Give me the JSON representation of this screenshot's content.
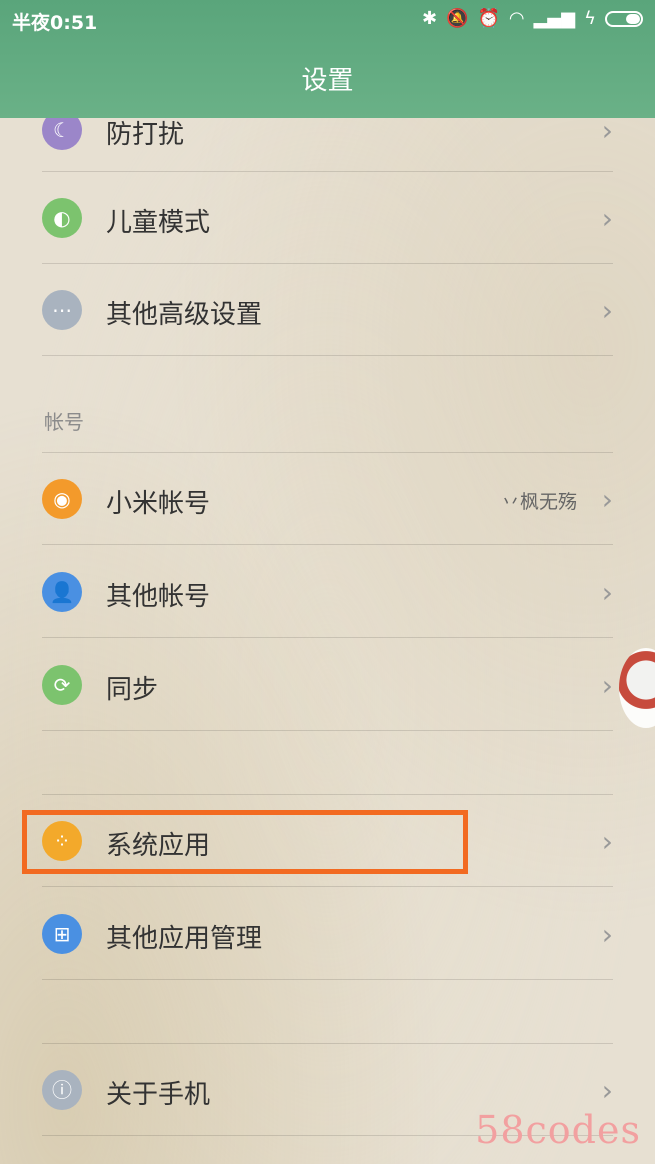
{
  "status_bar": {
    "time": "半夜0:51"
  },
  "header": {
    "title": "设置"
  },
  "items": [
    {
      "label": "防打扰",
      "icon": "moon-icon",
      "color": "#9b86c9"
    },
    {
      "label": "儿童模式",
      "icon": "child-mode-icon",
      "color": "#7cc36e"
    },
    {
      "label": "其他高级设置",
      "icon": "more-icon",
      "color": "#a9b3bf"
    }
  ],
  "account_section": {
    "title": "帐号"
  },
  "account_items": [
    {
      "label": "小米帐号",
      "value": "丷枫无殇",
      "icon": "mi-account-icon",
      "color": "#f39a2b"
    },
    {
      "label": "其他帐号",
      "icon": "user-add-icon",
      "color": "#4a90e2"
    },
    {
      "label": "同步",
      "icon": "sync-icon",
      "color": "#7cc36e"
    }
  ],
  "app_items": [
    {
      "label": "系统应用",
      "icon": "apps-icon",
      "color": "#f3a92b"
    },
    {
      "label": "其他应用管理",
      "icon": "apps-grid-icon",
      "color": "#4a90e2"
    }
  ],
  "about_item": {
    "label": "关于手机",
    "icon": "info-icon",
    "color": "#a9b3bf"
  },
  "watermark": "58codes",
  "colors": {
    "header": "#5aa57b",
    "highlight": "#f26a21"
  }
}
